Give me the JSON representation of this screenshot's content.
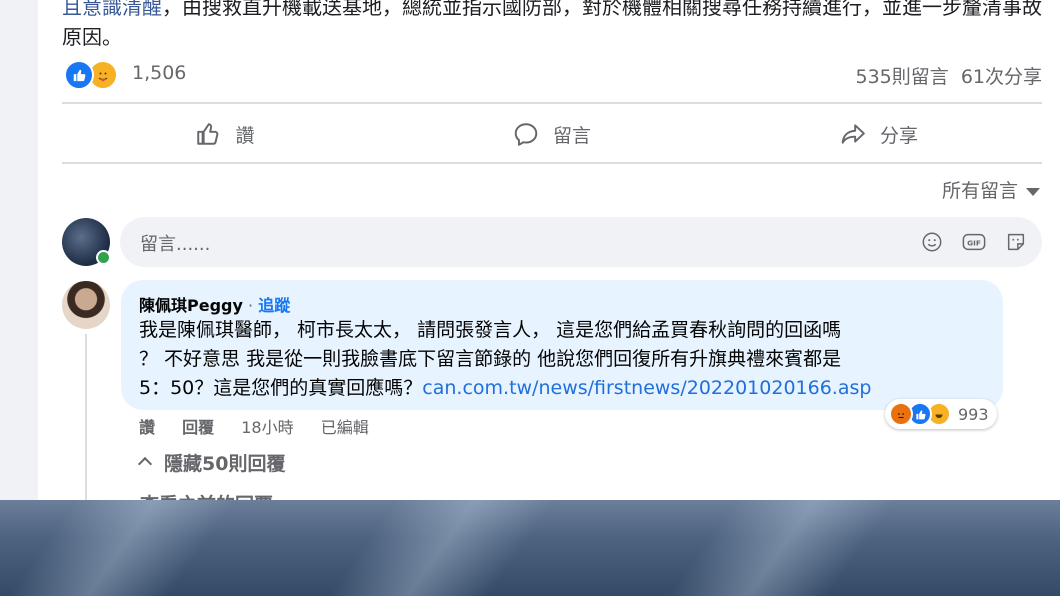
{
  "post": {
    "text_link": "且意識清醒",
    "text_rest": "，由搜救直升機載送基地，總統並指示國防部，對於機體相關搜尋任務持續進行，並進一步釐清事故原因。"
  },
  "stats": {
    "reactions_count": "1,506",
    "comments_count": "535則留言",
    "shares_count": "61次分享"
  },
  "actions": {
    "like": "讚",
    "comment": "留言",
    "share": "分享"
  },
  "sort": {
    "label": "所有留言"
  },
  "composer": {
    "placeholder": "留言......",
    "icons": [
      "emoji-icon",
      "gif-icon",
      "sticker-icon"
    ]
  },
  "comment": {
    "author": "陳佩琪Peggy",
    "separator": " · ",
    "follow": "追蹤",
    "text_line1": "我是陳佩琪醫師， 柯市長太太， 請問張發言人， 這是您們給孟買春秋詢問的回函嗎",
    "text_line2": "？ 不好意思 我是從一則我臉書底下留言節錄的 他說您們回復所有升旗典禮來賓都是",
    "text_line3": "5：50？這是您們的真實回應嗎？",
    "url": "can.com.tw/news/firstnews/202201020166.asp",
    "reaction_count": "993",
    "like_action": "讚",
    "reply_action": "回覆",
    "time": "18小時",
    "edited": "已編輯"
  },
  "replies": {
    "hide_label": "隱藏50則回覆",
    "next_label": "查看之前的回覆"
  },
  "colors": {
    "link": "#385898",
    "accent": "#1877f2",
    "bubble": "#e7f3ff",
    "muted": "#65676b"
  }
}
